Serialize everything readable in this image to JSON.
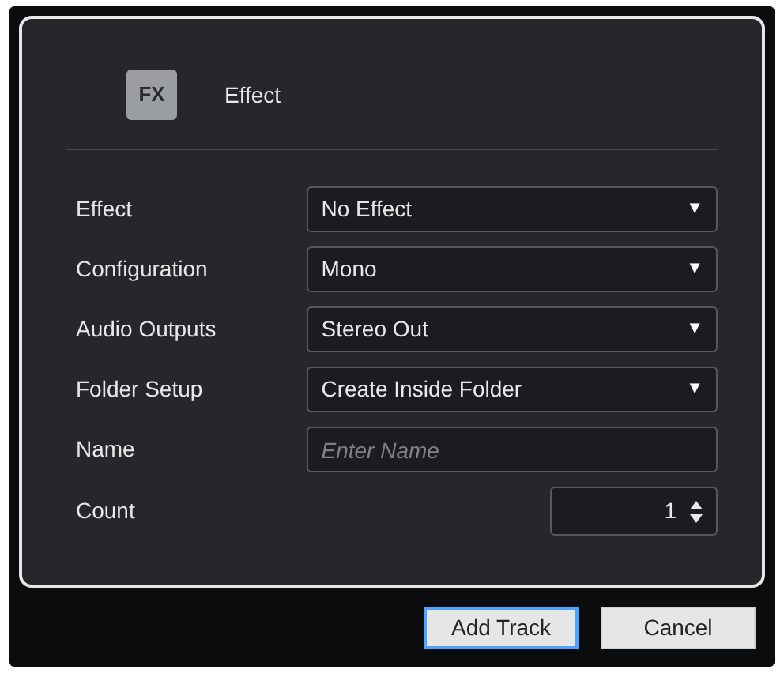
{
  "header": {
    "icon": "FX",
    "title": "Effect"
  },
  "fields": [
    {
      "label": "Effect",
      "kind": "dropdown",
      "value": "No Effect",
      "arrow": "▼"
    },
    {
      "label": "Configuration",
      "kind": "dropdown",
      "value": "Mono",
      "arrow": "▼"
    },
    {
      "label": "Audio Outputs",
      "kind": "dropdown",
      "value": "Stereo Out",
      "arrow": "▼"
    },
    {
      "label": "Folder Setup",
      "kind": "dropdown",
      "value": "Create Inside Folder",
      "arrow": "▼"
    },
    {
      "label": "Name",
      "kind": "text",
      "placeholder": "Enter Name"
    },
    {
      "label": "Count",
      "kind": "stepper",
      "value": "1"
    }
  ],
  "buttons": [
    {
      "label": "Add Track",
      "focused": true
    },
    {
      "label": "Cancel",
      "focused": false
    }
  ]
}
